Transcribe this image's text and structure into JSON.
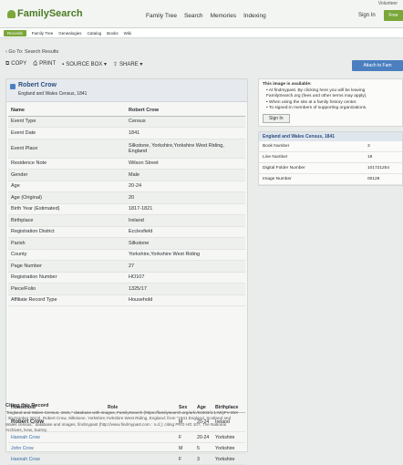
{
  "header": {
    "logo": "FamilySearch",
    "nav": [
      "Family Tree",
      "Search",
      "Memories",
      "Indexing"
    ],
    "volunteer": "Volunteer",
    "sign_in": "Sign In",
    "free_button": "Free"
  },
  "subnav": [
    "Records",
    "Family Tree",
    "Genealogies",
    "Catalog",
    "Books",
    "Wiki"
  ],
  "breadcrumb": "‹ Go To: Search Results",
  "toolbar": {
    "copy": "COPY",
    "print": "PRINT",
    "source_box": "SOURCE BOX ▾",
    "share": "SHARE ▾",
    "attach": "Attach to Fam"
  },
  "record": {
    "name": "Robert Crow",
    "collection": "England and Wales Census, 1841",
    "header_name": "Name",
    "header_value": "Robert Crow",
    "facts": [
      {
        "label": "Event Type",
        "value": "Census"
      },
      {
        "label": "Event Date",
        "value": "1841"
      },
      {
        "label": "Event Place",
        "value": "Silkstone, Yorkshire,Yorkshire West Riding, England"
      },
      {
        "label": "Residence Note",
        "value": "Wilson Street"
      },
      {
        "label": "Gender",
        "value": "Male"
      },
      {
        "label": "Age",
        "value": "20-24"
      },
      {
        "label": "Age (Original)",
        "value": "20"
      },
      {
        "label": "Birth Year (Estimated)",
        "value": "1817-1821"
      },
      {
        "label": "Birthplace",
        "value": "Ireland"
      },
      {
        "label": "Registration District",
        "value": "Ecclesfield"
      },
      {
        "label": "Parish",
        "value": "Silkstone"
      },
      {
        "label": "County",
        "value": "Yorkshire,Yorkshire West Riding"
      },
      {
        "label": "Page Number",
        "value": "27"
      },
      {
        "label": "Registration Number",
        "value": "HO107"
      },
      {
        "label": "Piece/Folio",
        "value": "1325/17"
      },
      {
        "label": "Affiliate Record Type",
        "value": "Household"
      }
    ]
  },
  "household": {
    "headers": [
      "Household",
      "Role",
      "Sex",
      "Age",
      "Birthplace"
    ],
    "rows": [
      {
        "name": "Robert Crow",
        "role": "",
        "sex": "M",
        "age": "20-24",
        "birthplace": "Ireland"
      },
      {
        "name": "Hannah Crow",
        "role": "",
        "sex": "F",
        "age": "20-24",
        "birthplace": "Yorkshire"
      },
      {
        "name": "John Crow",
        "role": "",
        "sex": "M",
        "age": "5",
        "birthplace": "Yorkshire"
      },
      {
        "name": "Hannah Crow",
        "role": "",
        "sex": "F",
        "age": "3",
        "birthplace": "Yorkshire"
      }
    ]
  },
  "citation": {
    "title": "Citing this Record",
    "text": "\"England and Wales Census, 1841,\" database with images, FamilySearch (https://familysearch.org/ark:/61903/1:1:MQFV-35X : 30 October 2013), Robert Crow, Silkstone, Yorkshire,Yorkshire West Riding, England; from \"1841 England, Scotland and Wales census,\" database and images, findmypast (http://www.findmypast.com : n.d.); citing PRO HO 107, The National Archives, Kew, Surrey."
  },
  "side": {
    "notice_title": "This image is available:",
    "notice_items": [
      "• At findmypast. By clicking here you will be leaving FamilySearch.org (fees and other terms may apply).",
      "• When using the site at a family history center.",
      "• To signed-in members of supporting organizations."
    ],
    "sign_in": "Sign In",
    "collection_title": "England and Wales Census, 1841",
    "details": [
      {
        "label": "Book Number",
        "value": "3"
      },
      {
        "label": "Line Number",
        "value": "19"
      },
      {
        "label": "Digital Folder Number",
        "value": "101721254"
      },
      {
        "label": "Image Number",
        "value": "00128"
      }
    ]
  },
  "colors": {
    "brand_green": "#7aa63a",
    "link_blue": "#3b6aa8",
    "button_blue": "#4b7fc0"
  }
}
